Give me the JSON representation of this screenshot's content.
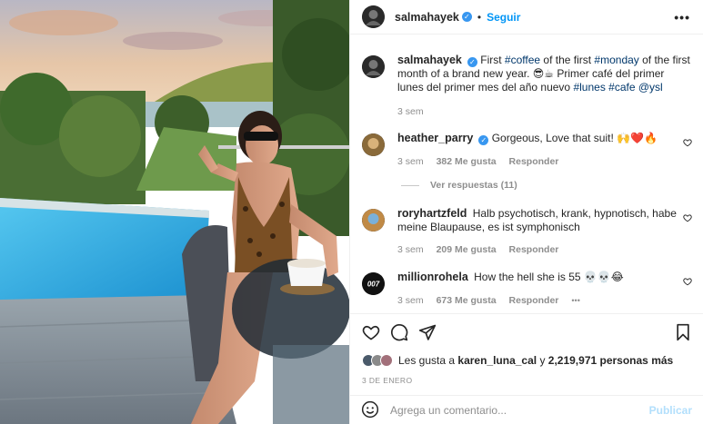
{
  "post": {
    "author": "salmahayek",
    "follow_label": "Seguir",
    "caption_author": "salmahayek",
    "caption_parts": {
      "p1": "First ",
      "tag1": "#coffee",
      "p2": " of the first ",
      "tag2": "#monday",
      "p3": " of the first month of a brand new year. 😎☕ Primer café del primer lunes del primer mes del año nuevo ",
      "tag3": "#lunes",
      "p4": " ",
      "tag4": "#cafe",
      "p5": " ",
      "tag5": "@ysl"
    },
    "caption_time": "3 sem"
  },
  "comments": [
    {
      "user": "heather_parry",
      "verified": true,
      "text": "Gorgeous, Love that suit! 🙌❤️🔥",
      "time": "3 sem",
      "likes": "382 Me gusta",
      "reply": "Responder",
      "view_replies": "Ver respuestas (11)"
    },
    {
      "user": "roryhartzfeld",
      "text": "Halb psychotisch, krank, hypnotisch, habe meine Blaupause, es ist symphonisch",
      "time": "3 sem",
      "likes": "209 Me gusta",
      "reply": "Responder"
    },
    {
      "user": "millionrohela",
      "text": "How the hell she is 55 💀💀😂",
      "time": "3 sem",
      "likes": "673 Me gusta",
      "reply": "Responder",
      "more": "•••"
    }
  ],
  "likes_summary": {
    "prefix": "Les gusta a ",
    "user": "karen_luna_cal",
    "mid": " y ",
    "count": "2,219,971 personas más"
  },
  "date": "3 DE ENERO",
  "comment_input": {
    "placeholder": "Agrega un comentario...",
    "publish_label": "Publicar"
  },
  "icons": [
    "more-options-icon",
    "heart-icon",
    "comment-icon",
    "share-icon",
    "bookmark-icon",
    "emoji-icon",
    "verified-icon"
  ],
  "colors": {
    "accent": "#0095f6",
    "verified": "#3897f0",
    "muted": "#8e8e8e",
    "link": "#00376b",
    "publish_disabled": "#b2dffc"
  }
}
